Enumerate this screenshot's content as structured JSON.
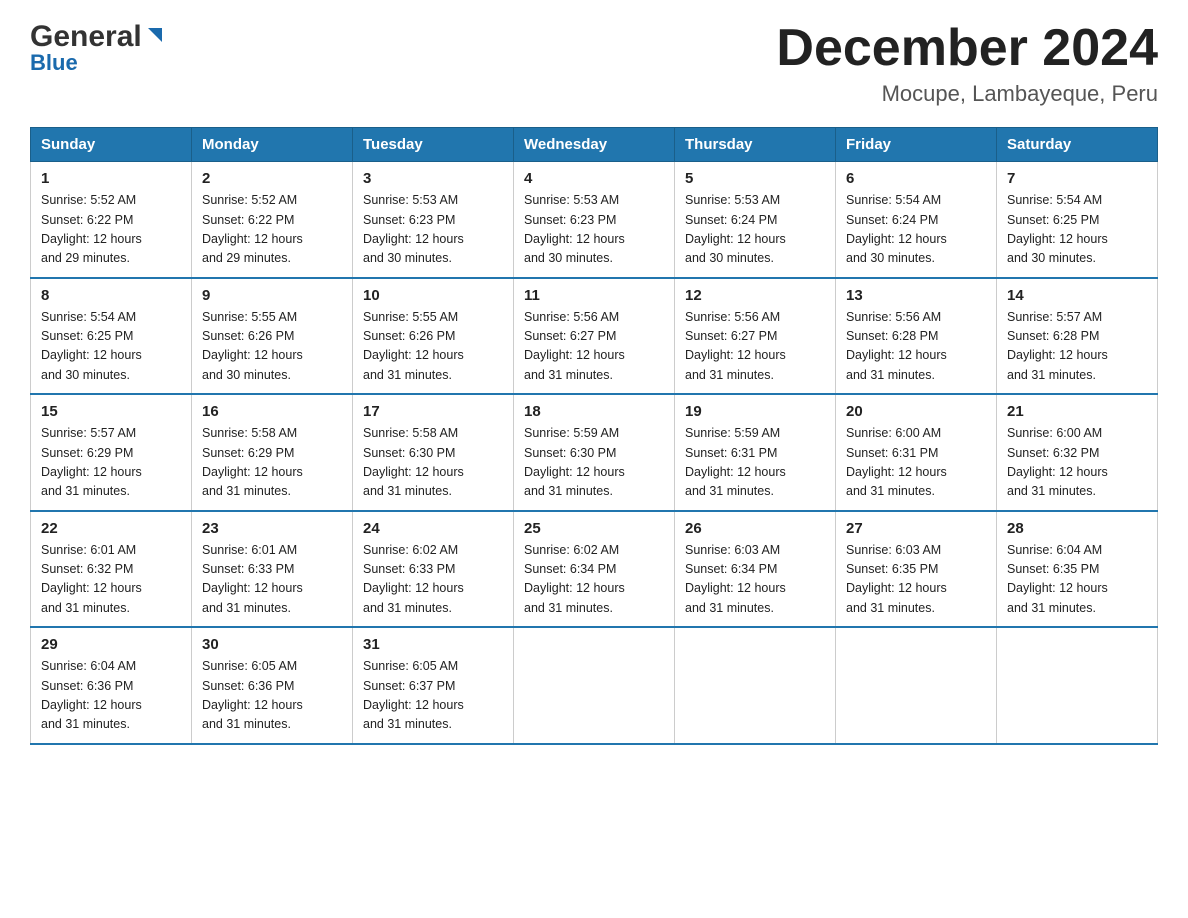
{
  "header": {
    "logo_general": "General",
    "logo_blue": "Blue",
    "title": "December 2024",
    "subtitle": "Mocupe, Lambayeque, Peru"
  },
  "days_of_week": [
    "Sunday",
    "Monday",
    "Tuesday",
    "Wednesday",
    "Thursday",
    "Friday",
    "Saturday"
  ],
  "weeks": [
    [
      {
        "day": "1",
        "sunrise": "5:52 AM",
        "sunset": "6:22 PM",
        "daylight": "12 hours and 29 minutes."
      },
      {
        "day": "2",
        "sunrise": "5:52 AM",
        "sunset": "6:22 PM",
        "daylight": "12 hours and 29 minutes."
      },
      {
        "day": "3",
        "sunrise": "5:53 AM",
        "sunset": "6:23 PM",
        "daylight": "12 hours and 30 minutes."
      },
      {
        "day": "4",
        "sunrise": "5:53 AM",
        "sunset": "6:23 PM",
        "daylight": "12 hours and 30 minutes."
      },
      {
        "day": "5",
        "sunrise": "5:53 AM",
        "sunset": "6:24 PM",
        "daylight": "12 hours and 30 minutes."
      },
      {
        "day": "6",
        "sunrise": "5:54 AM",
        "sunset": "6:24 PM",
        "daylight": "12 hours and 30 minutes."
      },
      {
        "day": "7",
        "sunrise": "5:54 AM",
        "sunset": "6:25 PM",
        "daylight": "12 hours and 30 minutes."
      }
    ],
    [
      {
        "day": "8",
        "sunrise": "5:54 AM",
        "sunset": "6:25 PM",
        "daylight": "12 hours and 30 minutes."
      },
      {
        "day": "9",
        "sunrise": "5:55 AM",
        "sunset": "6:26 PM",
        "daylight": "12 hours and 30 minutes."
      },
      {
        "day": "10",
        "sunrise": "5:55 AM",
        "sunset": "6:26 PM",
        "daylight": "12 hours and 31 minutes."
      },
      {
        "day": "11",
        "sunrise": "5:56 AM",
        "sunset": "6:27 PM",
        "daylight": "12 hours and 31 minutes."
      },
      {
        "day": "12",
        "sunrise": "5:56 AM",
        "sunset": "6:27 PM",
        "daylight": "12 hours and 31 minutes."
      },
      {
        "day": "13",
        "sunrise": "5:56 AM",
        "sunset": "6:28 PM",
        "daylight": "12 hours and 31 minutes."
      },
      {
        "day": "14",
        "sunrise": "5:57 AM",
        "sunset": "6:28 PM",
        "daylight": "12 hours and 31 minutes."
      }
    ],
    [
      {
        "day": "15",
        "sunrise": "5:57 AM",
        "sunset": "6:29 PM",
        "daylight": "12 hours and 31 minutes."
      },
      {
        "day": "16",
        "sunrise": "5:58 AM",
        "sunset": "6:29 PM",
        "daylight": "12 hours and 31 minutes."
      },
      {
        "day": "17",
        "sunrise": "5:58 AM",
        "sunset": "6:30 PM",
        "daylight": "12 hours and 31 minutes."
      },
      {
        "day": "18",
        "sunrise": "5:59 AM",
        "sunset": "6:30 PM",
        "daylight": "12 hours and 31 minutes."
      },
      {
        "day": "19",
        "sunrise": "5:59 AM",
        "sunset": "6:31 PM",
        "daylight": "12 hours and 31 minutes."
      },
      {
        "day": "20",
        "sunrise": "6:00 AM",
        "sunset": "6:31 PM",
        "daylight": "12 hours and 31 minutes."
      },
      {
        "day": "21",
        "sunrise": "6:00 AM",
        "sunset": "6:32 PM",
        "daylight": "12 hours and 31 minutes."
      }
    ],
    [
      {
        "day": "22",
        "sunrise": "6:01 AM",
        "sunset": "6:32 PM",
        "daylight": "12 hours and 31 minutes."
      },
      {
        "day": "23",
        "sunrise": "6:01 AM",
        "sunset": "6:33 PM",
        "daylight": "12 hours and 31 minutes."
      },
      {
        "day": "24",
        "sunrise": "6:02 AM",
        "sunset": "6:33 PM",
        "daylight": "12 hours and 31 minutes."
      },
      {
        "day": "25",
        "sunrise": "6:02 AM",
        "sunset": "6:34 PM",
        "daylight": "12 hours and 31 minutes."
      },
      {
        "day": "26",
        "sunrise": "6:03 AM",
        "sunset": "6:34 PM",
        "daylight": "12 hours and 31 minutes."
      },
      {
        "day": "27",
        "sunrise": "6:03 AM",
        "sunset": "6:35 PM",
        "daylight": "12 hours and 31 minutes."
      },
      {
        "day": "28",
        "sunrise": "6:04 AM",
        "sunset": "6:35 PM",
        "daylight": "12 hours and 31 minutes."
      }
    ],
    [
      {
        "day": "29",
        "sunrise": "6:04 AM",
        "sunset": "6:36 PM",
        "daylight": "12 hours and 31 minutes."
      },
      {
        "day": "30",
        "sunrise": "6:05 AM",
        "sunset": "6:36 PM",
        "daylight": "12 hours and 31 minutes."
      },
      {
        "day": "31",
        "sunrise": "6:05 AM",
        "sunset": "6:37 PM",
        "daylight": "12 hours and 31 minutes."
      },
      null,
      null,
      null,
      null
    ]
  ],
  "labels": {
    "sunrise": "Sunrise:",
    "sunset": "Sunset:",
    "daylight": "Daylight:"
  }
}
